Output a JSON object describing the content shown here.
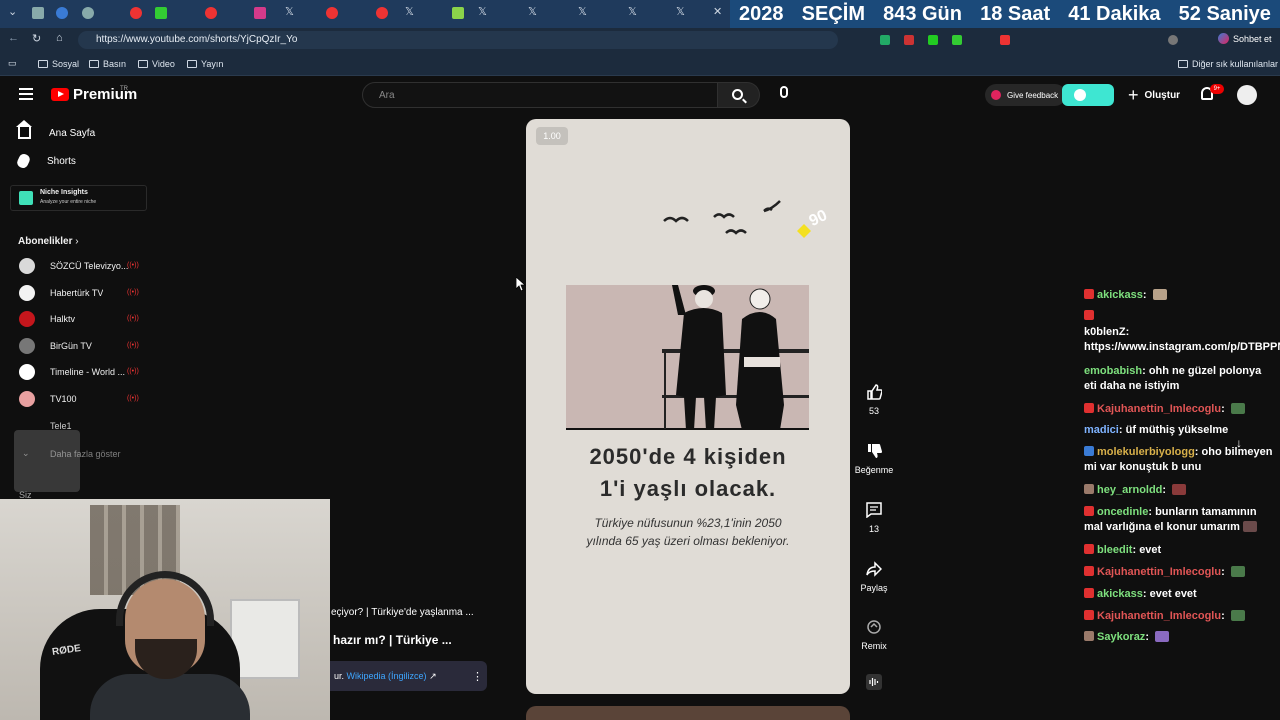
{
  "browser": {
    "url": "https://www.youtube.com/shorts/YjCpQzIr_Yo",
    "countdown": [
      "2028",
      "SEÇİM",
      "843 Gün",
      "18 Saat",
      "41 Dakika",
      "52 Saniye"
    ],
    "bookmarks": [
      "Sosyal",
      "Basın",
      "Video",
      "Yayın"
    ],
    "other_bookmarks": "Diğer sık kullanılanlar",
    "chat_button": "Sohbet et"
  },
  "header": {
    "logo": "Premium",
    "region": "TR",
    "search_placeholder": "Ara",
    "feedback": "Give feedback",
    "create": "Oluştur",
    "notifications": "9+"
  },
  "sidebar": {
    "home": "Ana Sayfa",
    "shorts": "Shorts",
    "niche_title": "Niche Insights",
    "niche_sub": "Analyze your entire niche",
    "subscriptions": "Abonelikler",
    "channels": [
      {
        "name": "SÖZCÜ Televizyo...",
        "color": "#d9d9d9",
        "live": true
      },
      {
        "name": "Habertürk TV",
        "color": "#f2f2f2",
        "live": true
      },
      {
        "name": "Halktv",
        "color": "#c4161c",
        "live": true
      },
      {
        "name": "BirGün TV",
        "color": "#777777",
        "live": true
      },
      {
        "name": "Timeline - World ...",
        "color": "#ffffff",
        "live": true
      },
      {
        "name": "TV100",
        "color": "#e8a0a0",
        "live": true
      }
    ],
    "tele1": "Tele1",
    "more": "Daha fazla göster",
    "you": "Siz"
  },
  "short": {
    "speed": "1.00",
    "title_line1": "2050'de 4 kişiden",
    "title_line2": "1'i yaşlı olacak.",
    "subtitle": "Türkiye nüfusunun %23,1'inin 2050 yılında 65 yaş üzeri olması bekleniyor.",
    "badge": "90",
    "overlay_line1": "eçiyor? | Türkiye'de yaşlanma ...",
    "overlay_line2": "hazır mı? | Türkiye ...",
    "wiki_prefix": "ur.",
    "wiki_link": "Wikipedia (İngilizce)",
    "chair_brand": "RØDE"
  },
  "actions": {
    "likes": "53",
    "dislike": "Beğenme",
    "comments": "13",
    "share": "Paylaş",
    "remix": "Remix"
  },
  "chat": [
    {
      "user": "akickass",
      "color": "#7ee07e",
      "text": "",
      "emote": "#b8a28a",
      "icon": "#e03030"
    },
    {
      "user": "",
      "color": "#ffffff",
      "text": "",
      "emote": "",
      "icon": "#e03030"
    },
    {
      "user": "k0blenZ",
      "color": "#ffffff",
      "text": "https://www.instagram.com/p/DTBPPNfjCX6/",
      "emote": "",
      "icon": ""
    },
    {
      "user": "emobabish",
      "color": "#7ee07e",
      "text": "ohh ne güzel polonya eti daha ne istiyim",
      "emote": "",
      "icon": ""
    },
    {
      "user": "Kajuhanettin_Imlecoglu",
      "color": "#e05555",
      "text": "",
      "emote": "#4a7a4a",
      "icon": "#e03030"
    },
    {
      "user": "madici",
      "color": "#7fb3ff",
      "text": "üf müthiş yükselme",
      "emote": "",
      "icon": ""
    },
    {
      "user": "molekulerbiyologg",
      "color": "#d8b04a",
      "text": "oho bilmeyen mi var konuştuk b unu",
      "emote": "",
      "icon": "#3a7bd5"
    },
    {
      "user": "hey_arnoldd",
      "color": "#7ee07e",
      "text": "",
      "emote": "#8a3a3a",
      "icon": "#9a7a6a"
    },
    {
      "user": "oncedinle",
      "color": "#7ee07e",
      "text": "bunların tamamının mal varlığına el konur umarım",
      "emote": "#6a4a4a",
      "icon": "#e03030"
    },
    {
      "user": "bleedit",
      "color": "#7ee07e",
      "text": "evet",
      "emote": "",
      "icon": "#e03030"
    },
    {
      "user": "Kajuhanettin_Imlecoglu",
      "color": "#e05555",
      "text": "",
      "emote": "#4a7a4a",
      "icon": "#e03030"
    },
    {
      "user": "akickass",
      "color": "#7ee07e",
      "text": "evet evet",
      "emote": "",
      "icon": "#e03030"
    },
    {
      "user": "Kajuhanettin_Imlecoglu",
      "color": "#e05555",
      "text": "",
      "emote": "#4a7a4a",
      "icon": "#e03030"
    },
    {
      "user": "Saykoraz",
      "color": "#7ee07e",
      "text": "",
      "emote": "#8a6ac0",
      "icon": "#9a7a6a"
    }
  ]
}
